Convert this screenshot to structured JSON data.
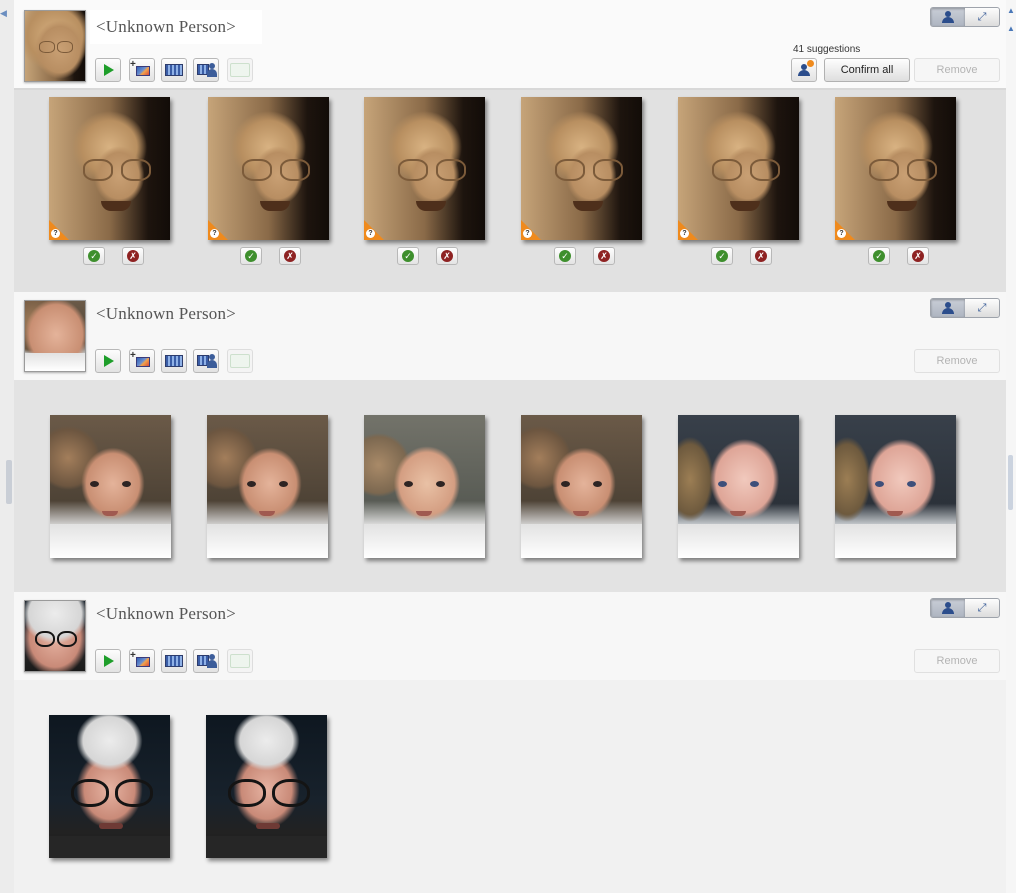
{
  "groups": [
    {
      "name": "<Unknown Person>",
      "suggestions": "41 suggestions",
      "confirm_all": "Confirm all",
      "remove": "Remove",
      "faces": [
        {
          "kind": "old-woman",
          "confirm": "✓",
          "reject": "✗"
        },
        {
          "kind": "old-woman",
          "confirm": "✓",
          "reject": "✗"
        },
        {
          "kind": "old-woman",
          "confirm": "✓",
          "reject": "✗"
        },
        {
          "kind": "old-woman",
          "confirm": "✓",
          "reject": "✗"
        },
        {
          "kind": "old-woman",
          "confirm": "✓",
          "reject": "✗"
        },
        {
          "kind": "old-woman",
          "confirm": "✓",
          "reject": "✗"
        }
      ],
      "badge_glyph": "?"
    },
    {
      "name": "<Unknown Person>",
      "remove": "Remove",
      "faces": [
        {
          "kind": "baby-a"
        },
        {
          "kind": "baby-a"
        },
        {
          "kind": "baby-a"
        },
        {
          "kind": "baby-b"
        },
        {
          "kind": "baby-c"
        },
        {
          "kind": "baby-c"
        }
      ]
    },
    {
      "name": "<Unknown Person>",
      "remove": "Remove",
      "faces": [
        {
          "kind": "old-man"
        },
        {
          "kind": "old-man"
        }
      ]
    }
  ],
  "toolbar_icons": [
    "play-icon",
    "add-to-album-icon",
    "add-to-slideshow-icon",
    "add-face-tag-icon",
    "add-person-icon"
  ],
  "view_toggle": [
    "person-view-icon",
    "expand-icon"
  ],
  "suggest_icon": "suggestion-question-icon",
  "colors": {
    "badge": "#ef8a1d",
    "confirm": "#3e8f2d",
    "reject": "#8e2222",
    "play": "#1e9e2a"
  }
}
